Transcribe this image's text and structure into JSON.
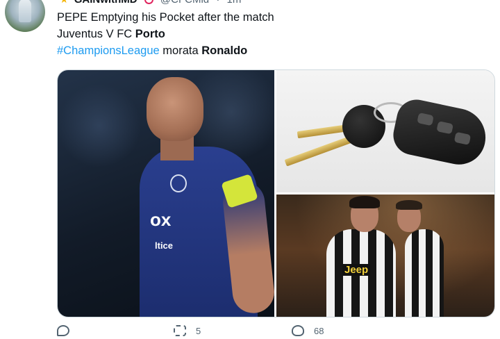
{
  "tweet": {
    "author_name": "GAINwithMD",
    "handle": "@CFCMid",
    "dot": "·",
    "time": "1m",
    "text": {
      "line1": "PEPE Emptying his Pocket after the match",
      "line2_prefix": "Juventus V FC ",
      "line2_bold": "Porto",
      "line3_hashtag": "#ChampionsLeague",
      "line3_middle": " morata ",
      "line3_bold": "Ronaldo"
    },
    "media": {
      "image1_sponsor": "ox",
      "image1_sponsor2": "ltice",
      "image3_sponsor": "Jeep"
    },
    "actions": {
      "reply_count": "",
      "retweet_count": "5",
      "like_count": "68"
    }
  },
  "colors": {
    "accent": "#1d9bf0",
    "badge": "#e0245e",
    "muted": "#536471"
  },
  "icons": [
    "star-icon",
    "verified-badge-icon",
    "more-icon",
    "reply-icon",
    "retweet-icon",
    "like-icon"
  ]
}
